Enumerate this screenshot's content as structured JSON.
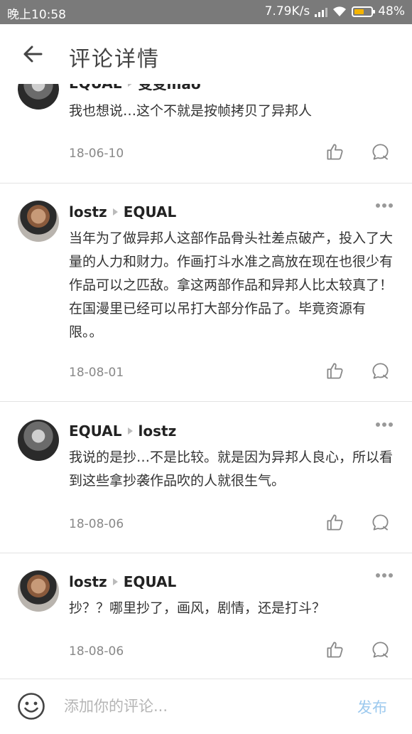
{
  "status_bar": {
    "time": "晚上10:58",
    "speed": "7.79K/s",
    "battery": "48%"
  },
  "header": {
    "title": "评论详情"
  },
  "comments": [
    {
      "author": "EQUAL",
      "reply_to": "变变mao",
      "text": "我也想说…这个不就是按帧拷贝了异邦人",
      "date": "18-06-10"
    },
    {
      "author": "lostz",
      "reply_to": "EQUAL",
      "text": "当年为了做异邦人这部作品骨头社差点破产，投入了大量的人力和财力。作画打斗水准之高放在现在也很少有作品可以之匹敌。拿这两部作品和异邦人比太较真了！在国漫里已经可以吊打大部分作品了。毕竟资源有限。。",
      "date": "18-08-01"
    },
    {
      "author": "EQUAL",
      "reply_to": "lostz",
      "text": "我说的是抄…不是比较。就是因为异邦人良心，所以看到这些拿抄袭作品吹的人就很生气。",
      "date": "18-08-06"
    },
    {
      "author": "lostz",
      "reply_to": "EQUAL",
      "text": "抄？？哪里抄了，画风，剧情，还是打斗？",
      "date": "18-08-06"
    }
  ],
  "bottom_bar": {
    "placeholder": "添加你的评论...",
    "publish_label": "发布"
  },
  "colors": {
    "accent": "#9cc9ee",
    "status_bar": "#7a7a7a",
    "divider": "#e3e3e3"
  },
  "icons": [
    "back-arrow-icon",
    "more-icon",
    "like-icon",
    "reply-icon",
    "emoji-icon",
    "wifi-icon",
    "signal-icon",
    "battery-icon"
  ]
}
